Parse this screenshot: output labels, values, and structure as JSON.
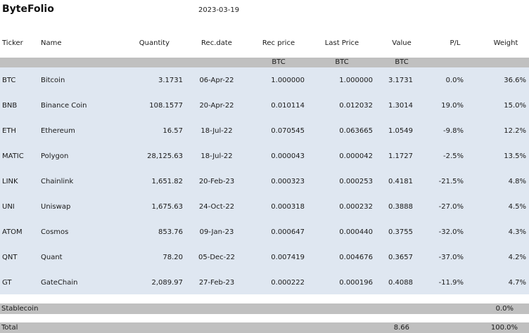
{
  "header": {
    "app_title": "ByteFolio",
    "date": "2023-03-19"
  },
  "columns": {
    "ticker": "Ticker",
    "name": "Name",
    "quantity": "Quantity",
    "rec_date": "Rec.date",
    "rec_price": "Rec price",
    "last_price": "Last Price",
    "value": "Value",
    "pl": "P/L",
    "weight": "Weight"
  },
  "units": {
    "rec_price": "BTC",
    "last_price": "BTC",
    "value": "BTC"
  },
  "rows": [
    {
      "ticker": "BTC",
      "name": "Bitcoin",
      "quantity": "3.1731",
      "rec_date": "06-Apr-22",
      "rec_price": "1.000000",
      "last_price": "1.000000",
      "value": "3.1731",
      "pl": "0.0%",
      "weight": "36.6%"
    },
    {
      "ticker": "BNB",
      "name": "Binance Coin",
      "quantity": "108.1577",
      "rec_date": "20-Apr-22",
      "rec_price": "0.010114",
      "last_price": "0.012032",
      "value": "1.3014",
      "pl": "19.0%",
      "weight": "15.0%"
    },
    {
      "ticker": "ETH",
      "name": "Ethereum",
      "quantity": "16.57",
      "rec_date": "18-Jul-22",
      "rec_price": "0.070545",
      "last_price": "0.063665",
      "value": "1.0549",
      "pl": "-9.8%",
      "weight": "12.2%"
    },
    {
      "ticker": "MATIC",
      "name": "Polygon",
      "quantity": "28,125.63",
      "rec_date": "18-Jul-22",
      "rec_price": "0.000043",
      "last_price": "0.000042",
      "value": "1.1727",
      "pl": "-2.5%",
      "weight": "13.5%"
    },
    {
      "ticker": "LINK",
      "name": "Chainlink",
      "quantity": "1,651.82",
      "rec_date": "20-Feb-23",
      "rec_price": "0.000323",
      "last_price": "0.000253",
      "value": "0.4181",
      "pl": "-21.5%",
      "weight": "4.8%"
    },
    {
      "ticker": "UNI",
      "name": "Uniswap",
      "quantity": "1,675.63",
      "rec_date": "24-Oct-22",
      "rec_price": "0.000318",
      "last_price": "0.000232",
      "value": "0.3888",
      "pl": "-27.0%",
      "weight": "4.5%"
    },
    {
      "ticker": "ATOM",
      "name": "Cosmos",
      "quantity": "853.76",
      "rec_date": "09-Jan-23",
      "rec_price": "0.000647",
      "last_price": "0.000440",
      "value": "0.3755",
      "pl": "-32.0%",
      "weight": "4.3%"
    },
    {
      "ticker": "QNT",
      "name": "Quant",
      "quantity": "78.20",
      "rec_date": "05-Dec-22",
      "rec_price": "0.007419",
      "last_price": "0.004676",
      "value": "0.3657",
      "pl": "-37.0%",
      "weight": "4.2%"
    },
    {
      "ticker": "GT",
      "name": "GateChain",
      "quantity": "2,089.97",
      "rec_date": "27-Feb-23",
      "rec_price": "0.000222",
      "last_price": "0.000196",
      "value": "0.4088",
      "pl": "-11.9%",
      "weight": "4.7%"
    }
  ],
  "stablecoin": {
    "label": "Stablecoin",
    "weight": "0.0%"
  },
  "total": {
    "label": "Total",
    "value": "8.66",
    "weight": "100.0%"
  },
  "colors": {
    "unit_band": "#c0c0c0",
    "data_band": "#dfe7f1"
  }
}
